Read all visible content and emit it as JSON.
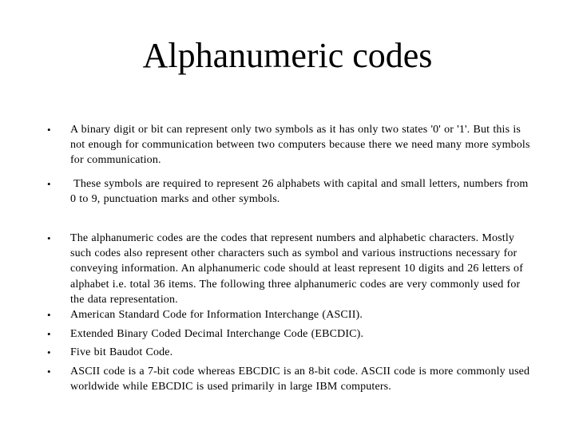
{
  "slide": {
    "title": "Alphanumeric codes",
    "bullet_glyph": "•",
    "bullets": [
      {
        "text": "A binary digit or bit can represent only two symbols as it has only two states '0' or '1'. But this is not enough for communication between two computers because there we need many more symbols for communication."
      },
      {
        "text": " These symbols are required to represent 26 alphabets with capital and small letters, numbers from 0 to 9, punctuation marks and other symbols."
      },
      {
        "text": "The alphanumeric codes are the codes that represent numbers and alphabetic characters. Mostly such codes also represent other characters such as symbol and various instructions necessary for conveying information. An alphanumeric code should at least represent 10 digits and 26 letters of alphabet i.e. total 36 items. The following three alphanumeric codes are very commonly used for the data representation."
      },
      {
        "text": "American Standard Code for Information Interchange (ASCII)."
      },
      {
        "text": "Extended Binary Coded Decimal Interchange Code (EBCDIC)."
      },
      {
        "text": "Five bit Baudot Code."
      },
      {
        "text": "ASCII code is a 7-bit code whereas EBCDIC is an 8-bit code. ASCII code is more commonly used worldwide while EBCDIC is used primarily in large IBM computers."
      }
    ]
  }
}
